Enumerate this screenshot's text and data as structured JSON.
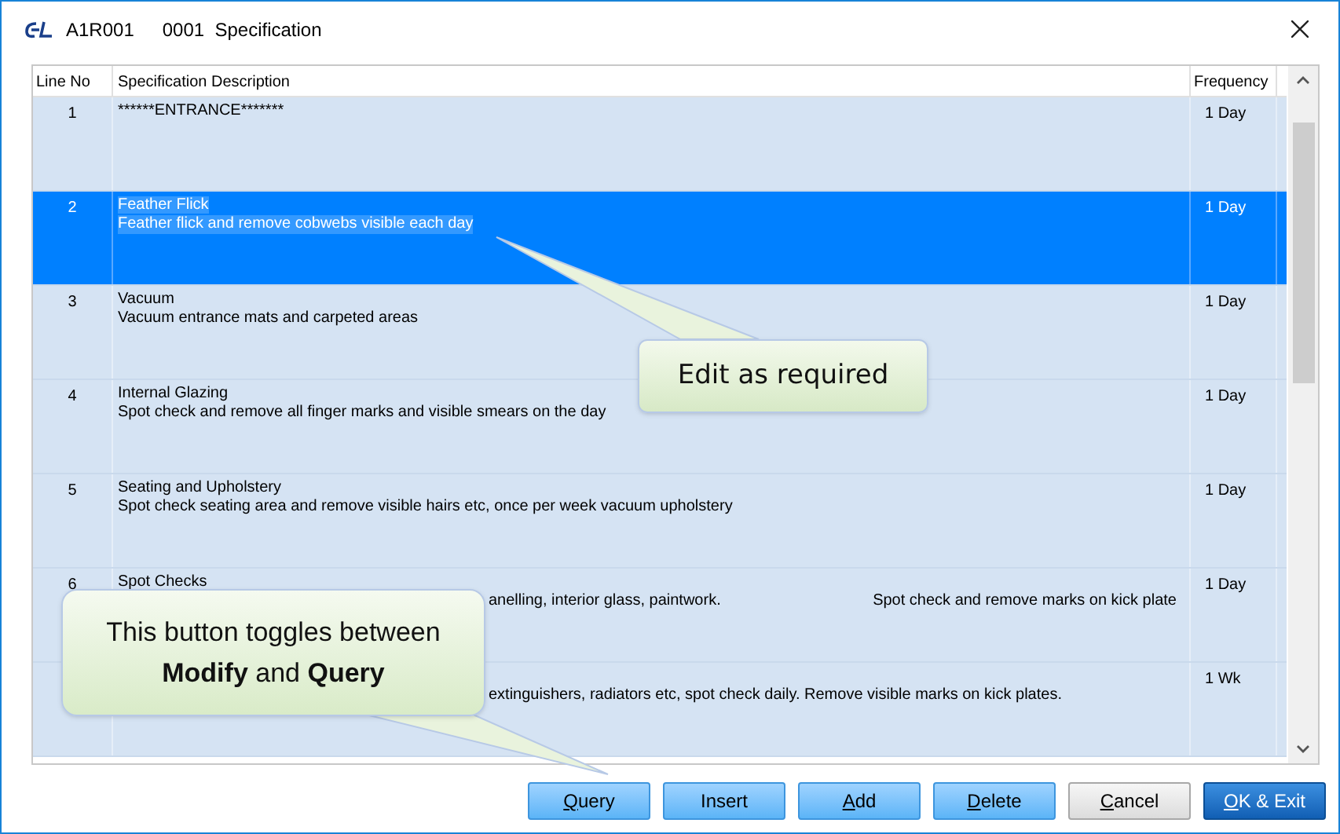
{
  "window": {
    "title_code": "A1R001",
    "title": "0001  Specification"
  },
  "table": {
    "columns": [
      "Line No",
      "Specification Description",
      "Frequency"
    ],
    "rows": [
      {
        "line_no": "1",
        "title": "******ENTRANCE*******",
        "details": [],
        "frequency": "1 Day",
        "selected": false
      },
      {
        "line_no": "2",
        "title": "Feather Flick",
        "details": [
          "Feather flick and remove cobwebs visible each day"
        ],
        "frequency": "1 Day",
        "selected": true,
        "kind": "plain"
      },
      {
        "line_no": "3",
        "title": "Vacuum",
        "details": [
          "Vacuum entrance mats and carpeted areas"
        ],
        "frequency": "1 Day",
        "selected": false,
        "kind": "plain"
      },
      {
        "line_no": "4",
        "title": "Internal Glazing",
        "details": [
          "Spot check and remove all finger marks and visible smears on the day"
        ],
        "frequency": "1 Day",
        "selected": false,
        "kind": "plain"
      },
      {
        "line_no": "5",
        "title": "Seating and Upholstery",
        "details": [
          "Spot check seating area and remove visible hairs etc, once per week vacuum upholstery"
        ],
        "frequency": "1 Day",
        "selected": false,
        "kind": "plain"
      },
      {
        "line_no": "6",
        "title": "Spot Checks",
        "details": [
          "anelling, interior glass, paintwork.",
          "Spot check and remove marks on kick plate"
        ],
        "frequency": "1 Day",
        "selected": false,
        "kind": "covered"
      },
      {
        "details": [
          "extinguishers, radiators etc, spot check daily. Remove visible marks on kick plates."
        ],
        "frequency": "1 Wk",
        "selected": false,
        "kind": "covered"
      }
    ]
  },
  "buttons": [
    {
      "key": "Q",
      "rest": "uery",
      "kind": "normal"
    },
    {
      "rest": "Insert",
      "kind": "normal"
    },
    {
      "key": "A",
      "rest": "dd",
      "kind": "normal"
    },
    {
      "key": "D",
      "rest": "elete",
      "kind": "normal"
    },
    {
      "key": "C",
      "rest": "ancel",
      "kind": "cancel"
    },
    {
      "key": "O",
      "rest": "K & Exit",
      "kind": "default"
    }
  ],
  "callouts": [
    {
      "text": "Edit as required",
      "kind": "top"
    },
    {
      "text": "This button toggles between **Modify** and **Query**",
      "kind": "bottom"
    }
  ]
}
